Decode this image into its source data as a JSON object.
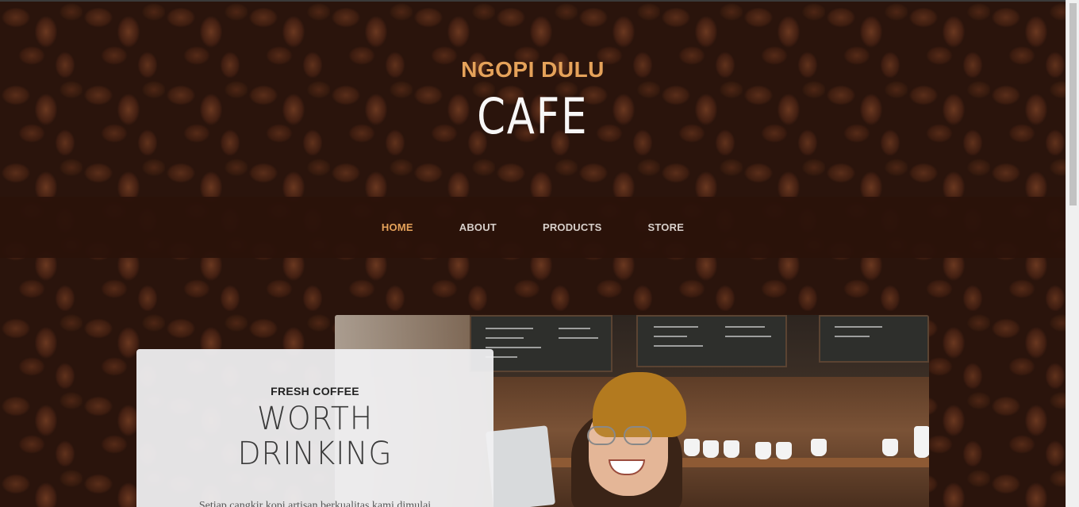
{
  "brand": {
    "upper": "NGOPI DULU",
    "lower": "CAFE"
  },
  "nav": {
    "items": [
      {
        "label": "HOME",
        "active": true
      },
      {
        "label": "ABOUT",
        "active": false
      },
      {
        "label": "PRODUCTS",
        "active": false
      },
      {
        "label": "STORE",
        "active": false
      }
    ]
  },
  "intro": {
    "kicker": "FRESH COFFEE",
    "headline_line1": "WORTH",
    "headline_line2": "DRINKING",
    "body": "Setiap cangkir kopi artisan berkualitas kami dimulai"
  },
  "colors": {
    "accent": "#e5a25a",
    "nav_background": "#2b120a",
    "card_background": "#f0f0f2"
  }
}
